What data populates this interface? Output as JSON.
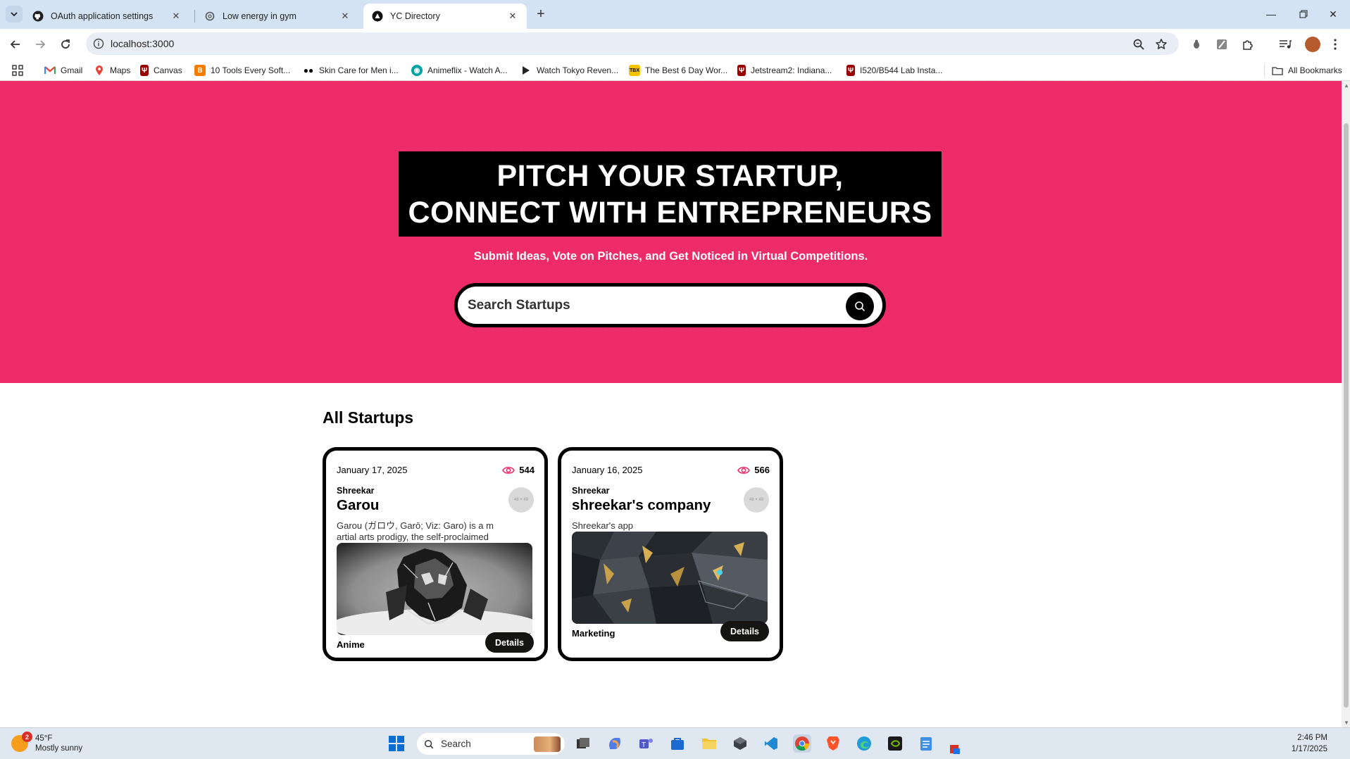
{
  "browser": {
    "tabs": [
      {
        "title": "OAuth application settings",
        "icon": "github-icon"
      },
      {
        "title": "Low energy in gym",
        "icon": "chatgpt-icon"
      },
      {
        "title": "YC Directory",
        "icon": "yc-icon",
        "active": true
      }
    ],
    "url": "localhost:3000",
    "bookmarks": [
      {
        "label": "Gmail",
        "icon": "gmail-icon",
        "color": "#ea4335"
      },
      {
        "label": "Maps",
        "icon": "maps-icon",
        "color": "#34a853"
      },
      {
        "label": "Canvas",
        "icon": "iu-icon",
        "color": "#990000"
      },
      {
        "label": "10 Tools Every Soft...",
        "icon": "blogger-icon",
        "color": "#f57c00"
      },
      {
        "label": "Skin Care for Men i...",
        "icon": "medium-icon",
        "color": "#000000"
      },
      {
        "label": "Animeflix - Watch A...",
        "icon": "animeflix-icon",
        "color": "#00a3a3"
      },
      {
        "label": "Watch Tokyo Reven...",
        "icon": "play-icon",
        "color": "#222222"
      },
      {
        "label": "The Best 6 Day Wor...",
        "icon": "tbx-icon",
        "color": "#f5c400"
      },
      {
        "label": "Jetstream2: Indiana...",
        "icon": "iu-icon",
        "color": "#990000"
      },
      {
        "label": "I520/B544 Lab Insta...",
        "icon": "iu-icon",
        "color": "#990000"
      }
    ],
    "all_bookmarks": "All Bookmarks"
  },
  "hero": {
    "title_line1": "PITCH YOUR STARTUP,",
    "title_line2": "CONNECT WITH ENTREPRENEURS",
    "subtitle": "Submit Ideas, Vote on Pitches, and Get Noticed in Virtual Competitions.",
    "search_placeholder": "Search Startups",
    "accent_color": "#ee2b69"
  },
  "startups": {
    "section_title": "All Startups",
    "cards": [
      {
        "date": "January 17, 2025",
        "views": "544",
        "author": "Shreekar",
        "title": "Garou",
        "avatar_text": "48 × 48",
        "description": "Garou (ガロウ, Garō; Viz: Garo) is a martial arts prodigy, the self-proclaimed \"Hero Hun...",
        "category": "Anime",
        "button": "Details"
      },
      {
        "date": "January 16, 2025",
        "views": "566",
        "author": "Shreekar",
        "title": "shreekar's company",
        "avatar_text": "48 × 48",
        "description": "Shreekar's app",
        "category": "Marketing",
        "button": "Details"
      }
    ]
  },
  "taskbar": {
    "weather_temp": "45°F",
    "weather_desc": "Mostly sunny",
    "weather_badge": "2",
    "search_label": "Search",
    "time": "2:46 PM",
    "date": "1/17/2025"
  }
}
